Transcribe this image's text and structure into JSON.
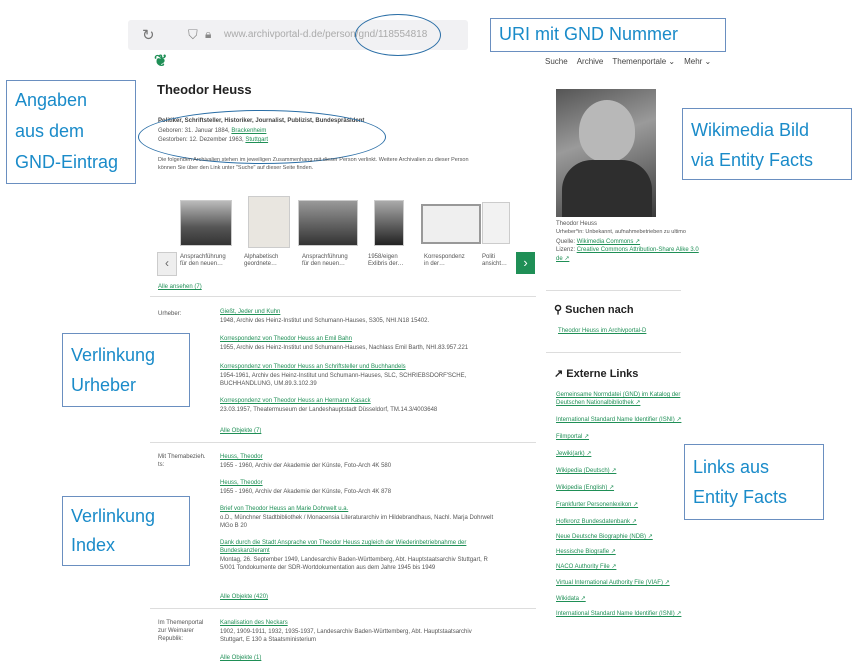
{
  "browser": {
    "url": "www.archivportal-d.de/person/gnd/118554818"
  },
  "callouts": {
    "uri": "URI mit GND Nummer",
    "gnd_line1": "Angaben",
    "gnd_line2": "aus dem",
    "gnd_line3": "GND-Eintrag",
    "wiki_line1": "Wikimedia Bild",
    "wiki_line2": "via Entity Facts",
    "urheber_line1": "Verlinkung",
    "urheber_line2": "Urheber",
    "index_line1": "Verlinkung",
    "index_line2": "Index",
    "links_line1": "Links aus",
    "links_line2": "Entity Facts"
  },
  "nav": {
    "logo": "❦",
    "items": [
      "Suche",
      "Archive",
      "Themenportale ⌄",
      "Mehr ⌄"
    ]
  },
  "person": {
    "name": "Theodor Heuss",
    "professions": "Politiker, Schriftsteller, Historiker, Journalist, Publizist, Bundespräsident",
    "born_label": "Geboren: 31. Januar 1884,",
    "born_place": "Brackenheim",
    "died_label": "Gestorben: 12. Dezember 1963,",
    "died_place": "Stuttgart",
    "note_line1": "Die folgenden Archivalien stehen im jeweiligen Zusammenhang mit dieser Person verlinkt. Weitere Archivalien zu dieser Person",
    "note_line2": "können Sie über den Link unter \"Suche\" auf dieser Seite finden."
  },
  "gallery": {
    "captions": [
      "Ansprachführung für den neuen…",
      "Alphabetisch geordnete…",
      "Ansprachführung für den neuen…",
      "1958/eigen Exlibris der…",
      "Korrespondenz in der…",
      "Politi ansicht…"
    ],
    "prev": "‹",
    "next": "›",
    "all_link": "Alle ansehen (7)"
  },
  "sections": [
    {
      "role": "Urheber:",
      "entries": [
        {
          "title": "Gießt, Jeder und Kuhn",
          "sub": "1948, Archiv des Heinz-Institut und Schumann-Hauses, S305, NHI.N18 15402."
        },
        {
          "title": "Korrespondenz von Theodor Heuss an Emil Bahn",
          "sub": "1955, Archiv des Heinz-Institut und Schumann-Hauses, Nachlass Emil Barth, NHI.83.957.221"
        },
        {
          "title": "Korrespondenz von Theodor Heuss an Schriftsteller und Buchhandels",
          "sub": "1954-1961, Archiv des Heinz-Institut und Schumann-Hauses, SLC, SCHRIEBSDORF'SCHE,",
          "sub2": "BUCHHANDLUNG, UM.89.3.102.39"
        },
        {
          "title": "Korrespondenz von Theodor Heuss an Hermann Kasack",
          "sub": "23.03.1957, Theatermuseum der Landeshauptstadt Düsseldorf, TM.14.3/4003648"
        }
      ],
      "more": "Alle Objekte (7)"
    },
    {
      "role": "Mit Themabezieh.",
      "role2": "ts:",
      "entries": [
        {
          "title": "Heuss, Theodor",
          "sub": "1955 - 1960, Archiv der Akademie der Künste, Foto-Arch 4K 580"
        },
        {
          "title": "Heuss, Theodor",
          "sub": "1955 - 1960, Archiv der Akademie der Künste, Foto-Arch 4K 878"
        },
        {
          "title": "Brief von Theodor Heuss an Marie Dohrwelt u.a.",
          "sub": "o.D., Münchner Stadtbibliothek / Monacensia Literaturarchiv im Hildebrandhaus, Nachl. Marja Dohrwelt",
          "sub2": "MGo B 20"
        },
        {
          "title": "Dank durch die Stadt Ansprache von Theodor Heuss zugleich der Wiederinbetriebnahme der",
          "title2": "Bundeskanzleramt",
          "sub": "Montag, 26. September 1949, Landesarchiv Baden-Württemberg, Abt. Hauptstaatsarchiv Stuttgart, R",
          "sub2": "5/001 Tondokumente der SDR-Wortdokumentation aus dem Jahre 1945 bis 1949"
        }
      ],
      "more": "Alle Objekte (420)"
    },
    {
      "role": "Im Themenportal",
      "role2": "zur Weimarer",
      "role3": "Republik:",
      "entries": [
        {
          "title": "Kanalisation des Neckars",
          "sub": "1902, 1909-1911, 1932, 1935-1937, Landesarchiv Baden-Württemberg, Abt. Hauptstaatsarchiv",
          "sub2": "Stuttgart, E 130 a Staatsministerium"
        }
      ],
      "more": "Alle Objekte (1)"
    }
  ],
  "sidebar": {
    "caption_name": "Theodor Heuss",
    "caption_desc": "Urheber*in: Unbekannt, aufnahmebetrieben zu ultimo",
    "source_label": "Quelle:",
    "source_link": "Wikimedia Commons ↗",
    "license_label": "Lizenz:",
    "license_link": "Creative Commons Attribution-Share Alike 3.0",
    "license_link2": "de ↗",
    "search_heading": "Suchen nach",
    "search_link": "Theodor Heuss im Archivportal-D",
    "links_heading": "Externe Links",
    "external_links": [
      "Gemeinsame Normdatei (GND) im Katalog der",
      "Deutschen Nationalbibliothek ↗",
      "International Standard Name Identifier (ISNI) ↗",
      "Filmportal ↗",
      "Jewiki(ark) ↗",
      "Wikipedia (Deutsch) ↗",
      "Wikipedia (English) ↗",
      "Frankfurter Personenlexikon ↗",
      "Hofkronz Bundesdatenbank ↗",
      "Neue Deutsche Biographie (NDB) ↗",
      "Hessische Biografie ↗",
      "NACO Authority File ↗",
      "Virtual International Authority File (VIAF) ↗",
      "Wikidata ↗",
      "International Standard Name Identifier (ISNI) ↗"
    ]
  }
}
